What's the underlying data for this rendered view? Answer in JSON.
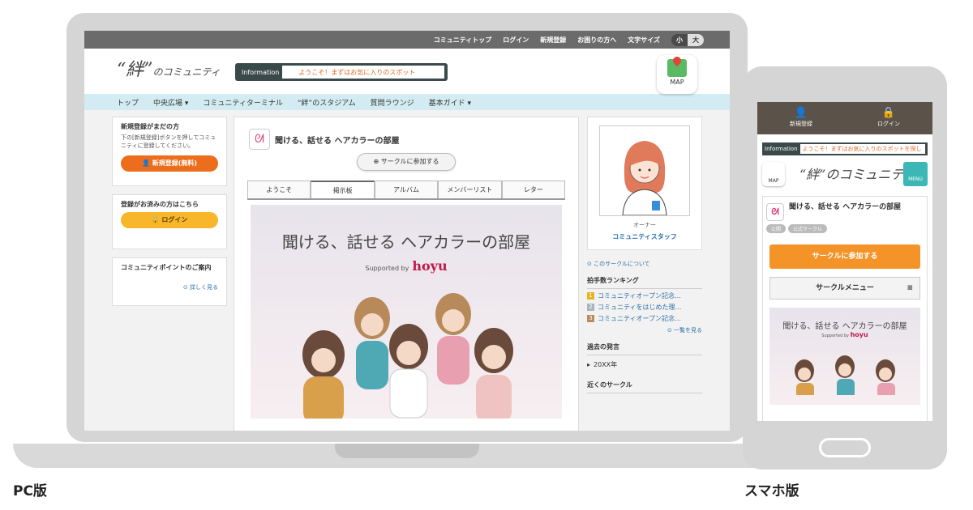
{
  "labels": {
    "pc": "PC版",
    "sp": "スマホ版"
  },
  "pc": {
    "topbar": [
      "コミュニティトップ",
      "ログイン",
      "新規登録",
      "お困りの方へ",
      "文字サイズ"
    ],
    "size_small": "小",
    "size_large": "大",
    "logo": "“絆”",
    "logo_tail": "のコミュニティ",
    "info_label": "Information",
    "info_msg": "ようこそ！まずはお気に入りのスポット",
    "map_label": "MAP",
    "nav": [
      "トップ",
      "中央広場 ▾",
      "コミュニティターミナル",
      "“絆”のスタジアム",
      "質問ラウンジ",
      "基本ガイド ▾"
    ],
    "side": {
      "reg_title": "新規登録がまだの方",
      "reg_desc": "下の[新規登録]ボタンを押してコミュニティに登録してください。",
      "reg_button": "👤 新規登録(無料)",
      "login_title": "登録がお済みの方はこちら",
      "login_button": "🔒 ログイン",
      "points_title": "コミュニティポイントのご案内",
      "points_link": "詳しく見る"
    },
    "circle": {
      "title": "聞ける、話せる ヘアカラーの部屋",
      "join": "サークルに参加する",
      "tabs": [
        "ようこそ",
        "掲示板",
        "アルバム",
        "メンバーリスト",
        "レター"
      ],
      "hero_title": "聞ける、話せる ヘアカラーの部屋",
      "hero_supported": "Supported by",
      "hero_brand": "hoyu"
    },
    "right": {
      "owner_role": "オーナー",
      "owner_name": "コミュニティスタッフ",
      "about_link": "このサークルについて",
      "ranking_title": "拍手数ランキング",
      "ranking": [
        "コミュニティオープン記念…",
        "コミュニティをはじめた理…",
        "コミュニティオープン記念…"
      ],
      "ranking_more": "一覧を見る",
      "past_title": "過去の発言",
      "past_item": "20XX年",
      "near_title": "近くのサークル"
    }
  },
  "sp": {
    "register": "新規登録",
    "login": "ログイン",
    "info_label": "Information",
    "info_msg": "ようこそ！まずはお気に入りのスポットを探し",
    "map": "MAP",
    "logo": "“絆”のコミュニティ",
    "menu": "MENU",
    "circle_title": "聞ける、話せる ヘアカラーの部屋",
    "tags": [
      "公開",
      "公式サークル"
    ],
    "join": "サークルに参加する",
    "circle_menu": "サークルメニュー",
    "hero_title": "聞ける、話せる ヘアカラーの部屋",
    "hero_supported": "Supported by",
    "hero_brand": "hoyu"
  }
}
